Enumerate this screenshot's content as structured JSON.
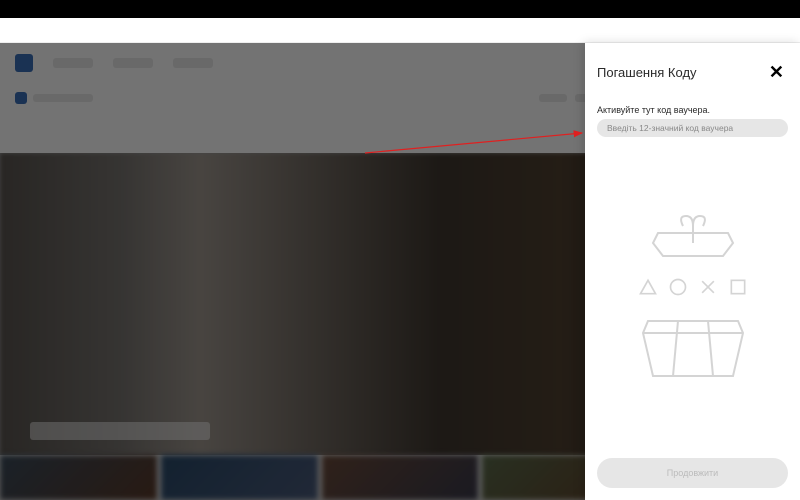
{
  "panel": {
    "title": "Погашення Коду",
    "instruction": "Активуйте тут код ваучера.",
    "input_placeholder": "Введіть 12-значний код ваучера",
    "continue_label": "Продовжити"
  },
  "icons": {
    "close": "✕",
    "triangle": "triangle-icon",
    "circle": "circle-icon",
    "cross": "cross-icon",
    "square": "square-icon",
    "gift_top": "gift-lid-icon",
    "gift_bottom": "gift-box-icon"
  },
  "colors": {
    "panel_bg": "#ffffff",
    "input_bg": "#e6e6e6",
    "illustration_stroke": "#d4d4d4",
    "arrow": "#e02020"
  }
}
